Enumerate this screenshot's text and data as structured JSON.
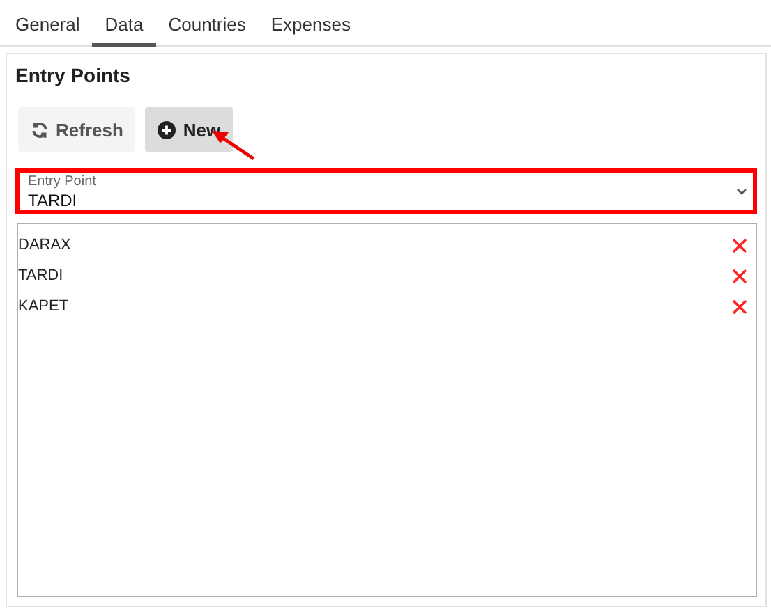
{
  "tabs": [
    {
      "label": "General",
      "selected": false
    },
    {
      "label": "Data",
      "selected": true
    },
    {
      "label": "Countries",
      "selected": false
    },
    {
      "label": "Expenses",
      "selected": false
    }
  ],
  "panel": {
    "title": "Entry Points",
    "buttons": [
      {
        "label": "Refresh",
        "kind": "refresh"
      },
      {
        "label": "New",
        "kind": "new"
      }
    ],
    "select": {
      "label": "Entry Point",
      "value": "TARDI"
    },
    "items": [
      {
        "name": "DARAX"
      },
      {
        "name": "TARDI"
      },
      {
        "name": "KAPET"
      }
    ]
  }
}
